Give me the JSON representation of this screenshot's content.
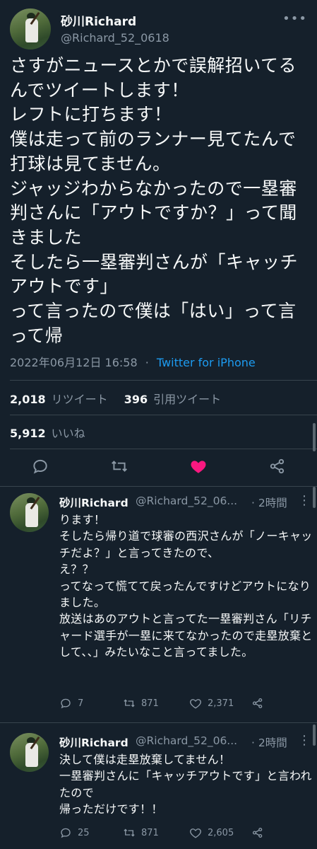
{
  "main_tweet": {
    "name": "砂川Richard",
    "handle": "@Richard_52_0618",
    "text": "さすがニュースとかで誤解招いてるんでツイートします！\nレフトに打ちます！\n僕は走って前のランナー見てたんで打球は見てません。\nジャッジわからなかったので一塁審判さんに「アウトですか？」って聞きました\nそしたら一塁審判さんが「キャッチアウトです」\nって言ったので僕は「はい」って言って帰",
    "timestamp": "2022年06月12日 16:58",
    "dot": "·",
    "source": "Twitter for iPhone",
    "retweets": "2,018",
    "retweets_label": "リツイート",
    "quotes": "396",
    "quotes_label": "引用ツイート",
    "likes": "5,912",
    "likes_label": "いいね"
  },
  "replies": [
    {
      "name": "砂川Richard",
      "handle": "@Richard_52_06...",
      "time": "· 2時間",
      "text": "ります！\nそしたら帰り道で球審の西沢さんが「ノーキャッチだよ？」と言ってきたので、\nえ？？\nってなって慌てて戻ったんですけどアウトになりました。\n放送はあのアウトと言ってた一塁審判さん「リチャード選手が一塁に来てなかったので走塁放棄として、、」みたいなこと言ってました。",
      "replies": "7",
      "retweets": "871",
      "likes": "2,371"
    },
    {
      "name": "砂川Richard",
      "handle": "@Richard_52_06...",
      "time": "· 2時間",
      "text": "決して僕は走塁放棄してません！\n一塁審判さんに「キャッチアウトです」と言われたので\n帰っただけです！！",
      "replies": "25",
      "retweets": "871",
      "likes": "2,605"
    }
  ],
  "colors": {
    "background": "#15202b",
    "text": "#f7f9f9",
    "muted": "#8b98a5",
    "link": "#1d9bf0",
    "like_active": "#f91880",
    "divider": "#38444d"
  },
  "icons": [
    "more-icon",
    "reply-icon",
    "retweet-icon",
    "like-icon",
    "share-icon"
  ]
}
